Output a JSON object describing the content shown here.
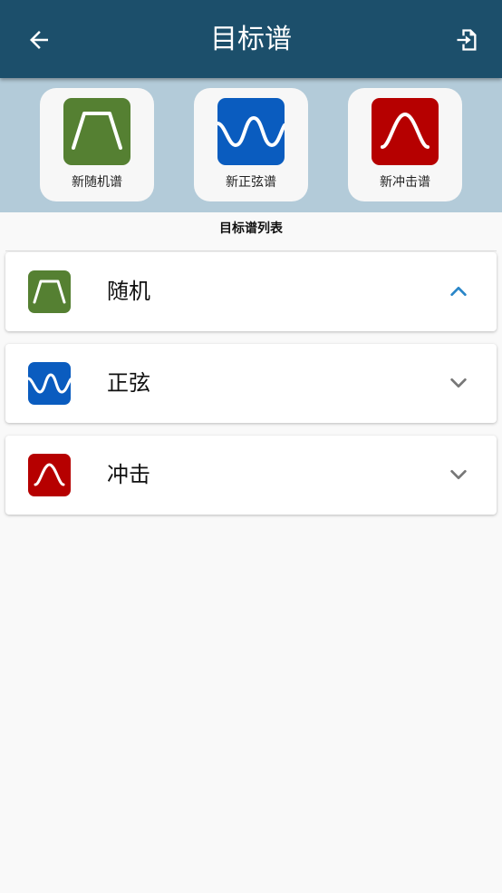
{
  "header": {
    "title": "目标谱",
    "back_icon": "arrow-left-icon",
    "exit_icon": "file-import-icon"
  },
  "new_buttons": [
    {
      "label": "新随机谱",
      "icon": "random-spectrum-icon",
      "color": "#558032"
    },
    {
      "label": "新正弦谱",
      "icon": "sine-spectrum-icon",
      "color": "#0a5cbf"
    },
    {
      "label": "新冲击谱",
      "icon": "shock-spectrum-icon",
      "color": "#b60000"
    }
  ],
  "list": {
    "title": "目标谱列表",
    "items": [
      {
        "label": "随机",
        "icon": "random-spectrum-icon",
        "expanded": true,
        "chevron": "chevron-up-icon"
      },
      {
        "label": "正弦",
        "icon": "sine-spectrum-icon",
        "expanded": false,
        "chevron": "chevron-down-icon"
      },
      {
        "label": "冲击",
        "icon": "shock-spectrum-icon",
        "expanded": false,
        "chevron": "chevron-down-icon"
      }
    ]
  },
  "colors": {
    "appbar": "#1c4f6b",
    "newbar": "#b3cbd9",
    "random": "#558032",
    "sine": "#0a5cbf",
    "shock": "#b60000",
    "chevron_active": "#2a86c8",
    "chevron_inactive": "#777777"
  }
}
